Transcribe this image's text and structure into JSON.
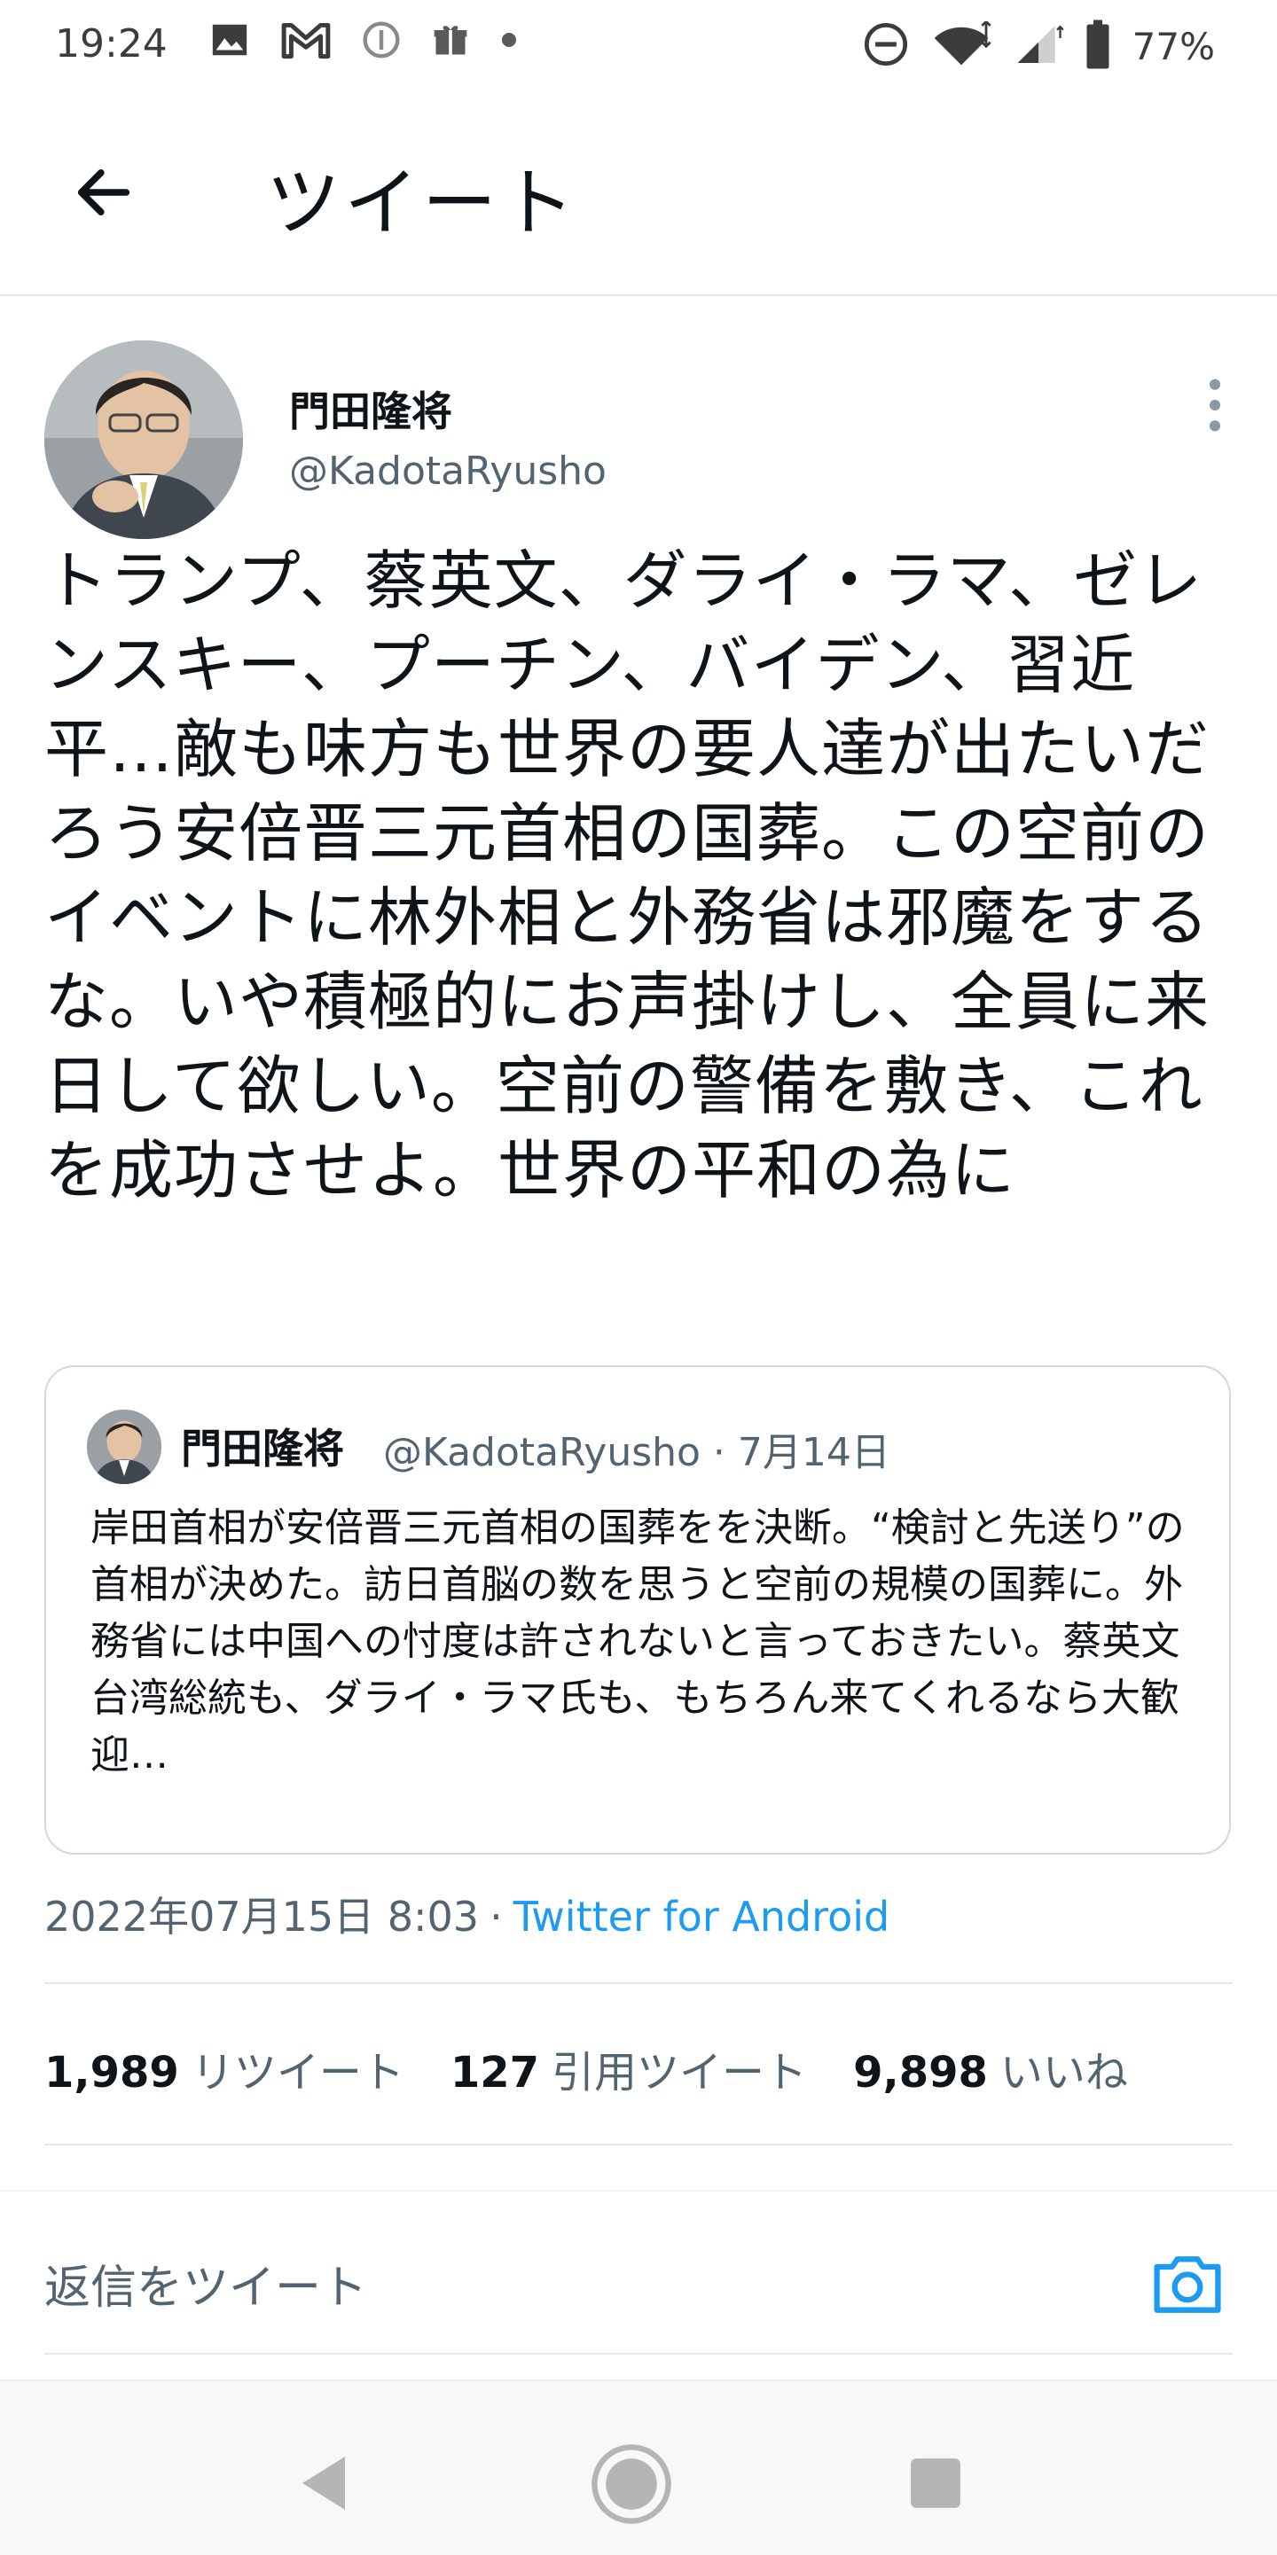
{
  "status_bar": {
    "time": "19:24",
    "battery": "77%",
    "left_icons": [
      "image-icon",
      "gmail-icon",
      "info-icon",
      "gift-icon",
      "dot-icon"
    ],
    "right_icons": [
      "do-not-disturb-icon",
      "wifi-icon",
      "signal-icon",
      "battery-icon"
    ]
  },
  "app_bar": {
    "title": "ツイート"
  },
  "tweet": {
    "author": {
      "name": "門田隆将",
      "handle": "@KadotaRyusho"
    },
    "text": "トランプ、蔡英文、ダライ・ラマ、ゼレンスキー、プーチン、バイデン、習近平…敵も味方も世界の要人達が出たいだろう安倍晋三元首相の国葬。この空前のイベントに林外相と外務省は邪魔をするな。いや積極的にお声掛けし、全員に来日して欲しい。空前の警備を敷き、これを成功させよ。世界の平和の為に",
    "quoted": {
      "name": "門田隆将",
      "meta": "@KadotaRyusho · 7月14日",
      "text": "岸田首相が安倍晋三元首相の国葬をを決断。“検討と先送り”の首相が決めた。訪日首脳の数を思うと空前の規模の国葬に。外務省には中国への忖度は許されないと言っておきたい。蔡英文台湾総統も、ダライ・ラマ氏も、もちろん来てくれるなら大歓迎…"
    },
    "timestamp": "2022年07月15日 8:03",
    "separator": "·",
    "source": "Twitter for Android",
    "stats": {
      "retweets_count": "1,989",
      "retweets_label": "リツイート",
      "quotes_count": "127",
      "quotes_label": "引用ツイート",
      "likes_count": "9,898",
      "likes_label": "いいね"
    }
  },
  "reply": {
    "placeholder": "返信をツイート"
  },
  "colors": {
    "accent": "#1d9bf0",
    "text_primary": "#0f1419",
    "text_secondary": "#536471",
    "border": "#cfd9de"
  }
}
